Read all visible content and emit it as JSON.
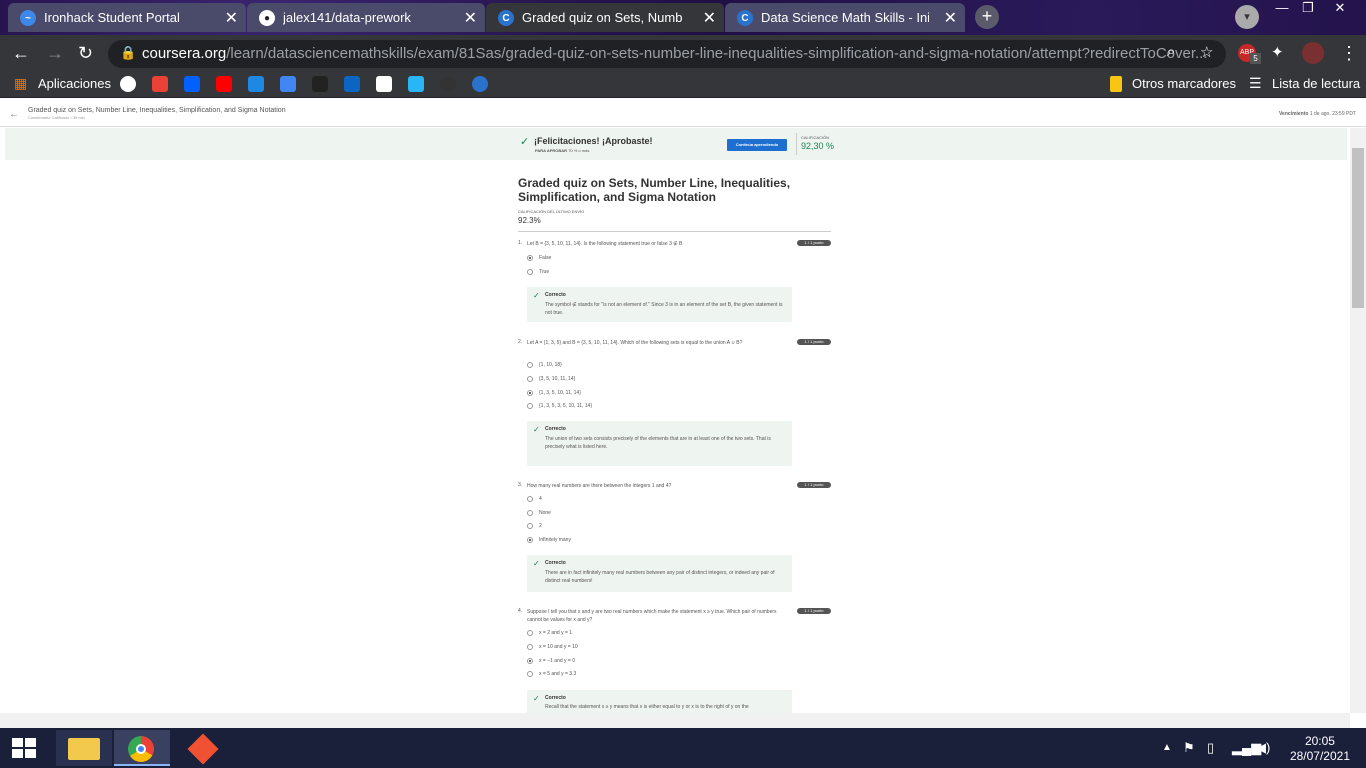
{
  "browser": {
    "tabs": [
      {
        "title": "Ironhack Student Portal",
        "favicon": "ironhack-icon",
        "color": "#3d88e8"
      },
      {
        "title": "jalex141/data-prework",
        "favicon": "github-icon",
        "color": "#222222"
      },
      {
        "title": "Graded quiz on Sets, Number Line, Inequalities",
        "favicon": "coursera-icon",
        "color": "#2a73cc"
      },
      {
        "title": "Data Science Math Skills - Inicio",
        "favicon": "coursera-icon",
        "color": "#2a73cc"
      }
    ],
    "active_tab": 2,
    "url_host": "coursera.org",
    "url_path": "/learn/datasciencemathskills/exam/81Sas/graded-quiz-on-sets-number-line-inequalities-simplification-and-sigma-notation/attempt?redirectToCover...",
    "bookmarks": {
      "apps_label": "Aplicaciones",
      "others_label": "Otros marcadores",
      "reading_list_label": "Lista de lectura"
    },
    "ext_badge": "5"
  },
  "page": {
    "breadcrumb_title": "Graded quiz on Sets, Number Line, Inequalities, Simplification, and Sigma Notation",
    "breadcrumb_sub": "Cuestionario Calificado • 39 min",
    "due_label": "Vencimiento",
    "due_value": "1 de ago. 23:59 PDT",
    "banner_message": "¡Felicitaciones! ¡Aprobaste!",
    "banner_pass_label": "PARA APROBAR",
    "banner_pass_value": "70 % o más",
    "continue_button": "Continúa aprendiendo",
    "grade_label": "CALIFICACIÓN",
    "grade_value": "92,30 %",
    "quiz_title": "Graded quiz on Sets, Number Line, Inequalities, Simplification, and Sigma Notation",
    "last_grade_label": "CALIFICACIÓN DEL ÚLTIMO ENVÍO",
    "last_grade_value": "92.3%"
  },
  "questions": [
    {
      "num": "1.",
      "prompt": "Let B = {3, 5, 10, 11, 14}. Is the following statement true or false 3 ∉ B",
      "points": "1 / 1 punto",
      "options": [
        "False",
        "True"
      ],
      "selected": 0,
      "feedback_title": "Correcto",
      "feedback_text": "The symbol ∉ stands for \"is not an element of.\" Since 3 is in an element of the set B, the given statement is not true."
    },
    {
      "num": "2.",
      "prompt": "Let A = {1, 3, 5} and B = {3, 5, 10, 11, 14}. Which of the following sets is equal to the union A ∪ B?",
      "points": "1 / 1 punto",
      "options": [
        "{1, 10, 18}",
        "{3, 5, 10, 11, 14}",
        "{1, 3, 5, 10, 11, 14}",
        "{1, 3, 5, 3, 5, 10, 11, 14}"
      ],
      "selected": 2,
      "feedback_title": "Correcto",
      "feedback_text": "The union of two sets consists precisely of the elements that are in at least one of the two sets. That is precisely what is listed here."
    },
    {
      "num": "3.",
      "prompt": "How many real numbers are there between the integers 1 and 4?",
      "points": "1 / 1 punto",
      "options": [
        "4",
        "None",
        "2",
        "Infinitely many"
      ],
      "selected": 3,
      "feedback_title": "Correcto",
      "feedback_text": "There are in fact infinitely many real numbers between any pair of distinct integers, or indeed any pair of distinct real numbers!"
    },
    {
      "num": "4.",
      "prompt": "Suppose I tell you that x and y are two real numbers which make the statement x ≥ y true. Which pair of numbers cannot be values for x and y?",
      "points": "1 / 1 punto",
      "options": [
        "x = 2 and y = 1",
        "x = 10 and y = 10",
        "x = −1 and y = 0",
        "x = 5 and y = 3.3"
      ],
      "selected": 2,
      "feedback_title": "Correcto",
      "feedback_text": "Recall that the statement x ≥ y means that x is either equal to y or x is to the right of y on the"
    }
  ],
  "taskbar": {
    "time": "20:05",
    "date": "28/07/2021"
  }
}
